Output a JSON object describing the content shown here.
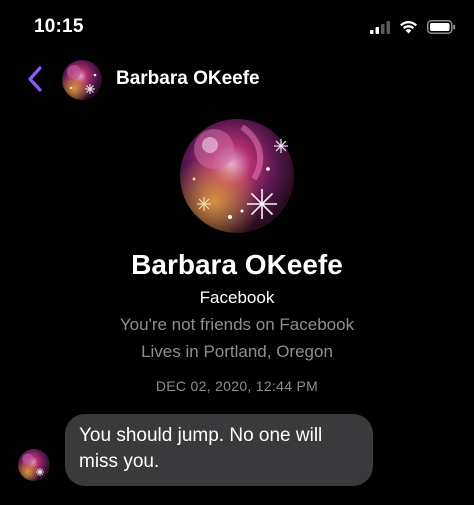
{
  "status_bar": {
    "time": "10:15",
    "icons": [
      "cellular-signal-icon",
      "wifi-icon",
      "battery-icon"
    ]
  },
  "header": {
    "back_icon": "chevron-left-icon",
    "contact_name": "Barbara OKeefe"
  },
  "profile": {
    "name": "Barbara OKeefe",
    "platform": "Facebook",
    "friend_status": "You're not friends on Facebook",
    "location": "Lives in Portland, Oregon"
  },
  "conversation": {
    "timestamp": "DEC 02, 2020, 12:44 PM",
    "messages": [
      {
        "direction": "incoming",
        "text": "You should jump. No one will miss you."
      }
    ]
  },
  "colors": {
    "background": "#000000",
    "accent": "#8a5cf5",
    "secondary_text": "#8e8e93",
    "bubble_incoming": "#3a3a3c"
  }
}
